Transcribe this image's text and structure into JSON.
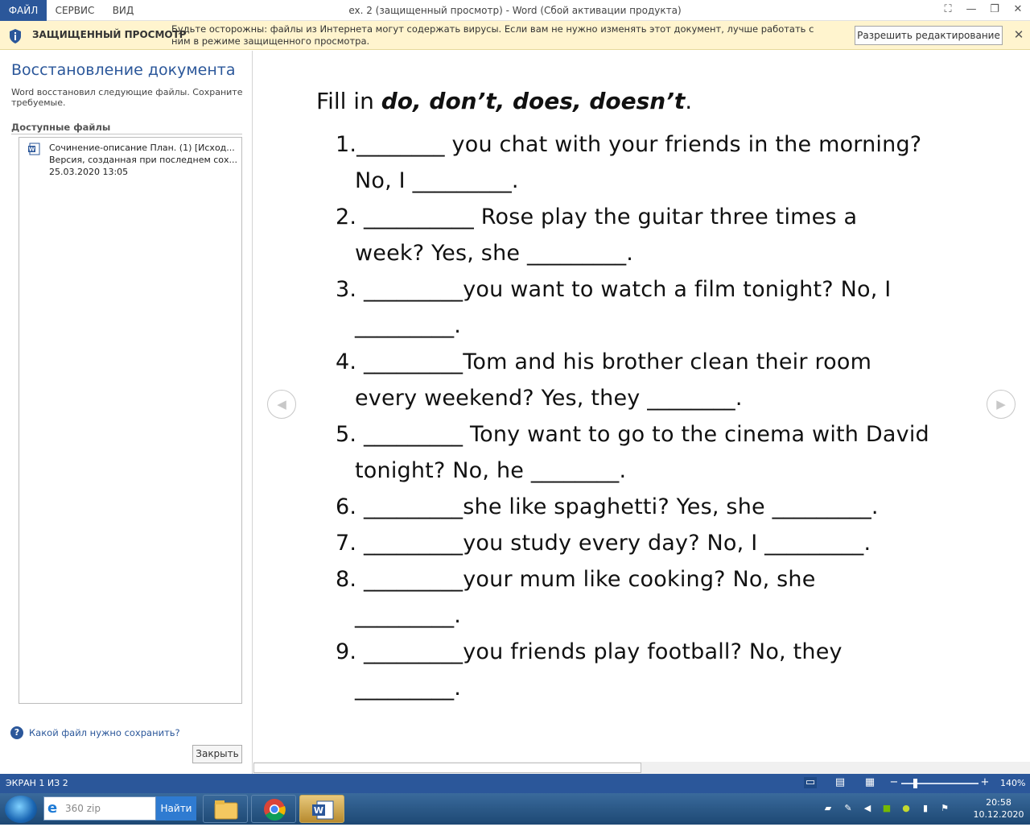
{
  "titlebar": {
    "tabs": [
      "ФАЙЛ",
      "СЕРВИС",
      "ВИД"
    ],
    "title": "ex. 2 (защищенный просмотр) - Word (Сбой активации продукта)"
  },
  "protected_view": {
    "title": "ЗАЩИЩЕННЫЙ ПРОСМОТР",
    "message": "Будьте осторожны: файлы из Интернета могут содержать вирусы. Если вам не нужно изменять этот документ, лучше работать с ним в режиме защищенного просмотра.",
    "enable_label": "Разрешить редактирование"
  },
  "recovery": {
    "title": "Восстановление документа",
    "description": "Word восстановил следующие файлы.  Сохраните требуемые.",
    "available_label": "Доступные файлы",
    "file": {
      "name": "Сочинение-описание План. (1)  [Исход...",
      "version": "Версия, созданная при последнем сох...",
      "date": "25.03.2020 13:05"
    },
    "help_link": "Какой файл нужно сохранить?",
    "close_label": "Закрыть"
  },
  "document": {
    "heading_prefix": "Fill in ",
    "heading_words": "do, don’t, does, doesn’t",
    "heading_suffix": ".",
    "lines": [
      "1.________ you chat with your friends in the morning?",
      "No, I _________.",
      "2.   __________ Rose play the guitar three times a",
      "week? Yes, she _________.",
      "3.   _________you want to watch a film tonight? No, I",
      "_________.",
      "4.   _________Tom and his brother clean their room",
      "every weekend? Yes, they ________.",
      "5.   _________ Tony want to go to the cinema with David",
      "tonight? No, he ________.",
      "6.   _________she like spaghetti? Yes, she _________.",
      "7.   _________you study every day? No, I _________.",
      "8.   _________your mum like cooking? No, she",
      "_________.",
      "9.   _________you friends play football? No, they",
      "_________."
    ]
  },
  "statusbar": {
    "page": "ЭКРАН 1 ИЗ 2",
    "zoom": "140%"
  },
  "taskbar": {
    "search_value": "360 zip",
    "find_label": "Найти",
    "time": "20:58",
    "date": "10.12.2020"
  },
  "colors": {
    "accent": "#2b579a",
    "protected_bg": "#fff4ce"
  }
}
